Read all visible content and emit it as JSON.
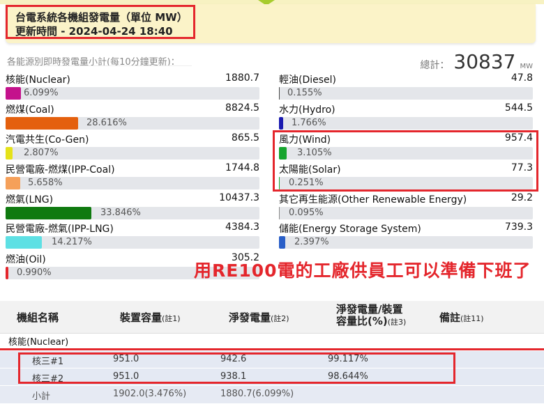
{
  "header": {
    "title": "台電系統各機組發電量（單位 MW）",
    "updated": "更新時間 - 2024-04-24 18:40"
  },
  "summary": {
    "subtitle": "各能源別即時發電量小計(每10分鐘更新)：",
    "total_label": "總計：",
    "total_value": "30837",
    "total_unit": "MW"
  },
  "sources_left": [
    {
      "name": "核能(Nuclear)",
      "value": "1880.7",
      "pct": "6.099%",
      "fraction": 0.061,
      "color": "#c4128c"
    },
    {
      "name": "燃煤(Coal)",
      "value": "8824.5",
      "pct": "28.616%",
      "fraction": 0.286,
      "color": "#e4600e"
    },
    {
      "name": "汽電共生(Co-Gen)",
      "value": "865.5",
      "pct": "2.807%",
      "fraction": 0.028,
      "color": "#e5e21a"
    },
    {
      "name": "民營電廠-燃煤(IPP-Coal)",
      "value": "1744.8",
      "pct": "5.658%",
      "fraction": 0.057,
      "color": "#f5a05a"
    },
    {
      "name": "燃氣(LNG)",
      "value": "10437.3",
      "pct": "33.846%",
      "fraction": 0.338,
      "color": "#0f7a10"
    },
    {
      "name": "民營電廠-燃氣(IPP-LNG)",
      "value": "4384.3",
      "pct": "14.217%",
      "fraction": 0.142,
      "color": "#5ee0e4"
    },
    {
      "name": "燃油(Oil)",
      "value": "305.2",
      "pct": "0.990%",
      "fraction": 0.0099,
      "color": "#e4262c"
    }
  ],
  "sources_right": [
    {
      "name": "輕油(Diesel)",
      "value": "47.8",
      "pct": "0.155%",
      "fraction": 0.00155,
      "color": "#444444"
    },
    {
      "name": "水力(Hydro)",
      "value": "544.5",
      "pct": "1.766%",
      "fraction": 0.0177,
      "color": "#1a1ab0"
    },
    {
      "name": "風力(Wind)",
      "value": "957.4",
      "pct": "3.105%",
      "fraction": 0.031,
      "color": "#17a52e"
    },
    {
      "name": "太陽能(Solar)",
      "value": "77.3",
      "pct": "0.251%",
      "fraction": 0.0025,
      "color": "#17a52e"
    },
    {
      "name": "其它再生能源(Other Renewable Energy)",
      "value": "29.2",
      "pct": "0.095%",
      "fraction": 0.00095,
      "color": "#888888"
    },
    {
      "name": "儲能(Energy Storage System)",
      "value": "739.3",
      "pct": "2.397%",
      "fraction": 0.024,
      "color": "#2a5fc8"
    }
  ],
  "slogan": "用RE100電的工廠供員工可以準備下班了",
  "table": {
    "headers": {
      "unit_name": "機組名稱",
      "capacity": "裝置容量",
      "capacity_note": "(註1)",
      "net_output": "淨發電量",
      "net_output_note": "(註2)",
      "ratio_line1": "淨發電量/裝置",
      "ratio_line2": "容量比(%)",
      "ratio_note": "(註3)",
      "remark": "備註",
      "remark_note": "(註11)"
    },
    "group": "核能(Nuclear)",
    "rows": [
      {
        "name": "核三#1",
        "capacity": "951.0",
        "net": "942.6",
        "ratio": "99.117%"
      },
      {
        "name": "核三#2",
        "capacity": "951.0",
        "net": "938.1",
        "ratio": "98.644%"
      }
    ],
    "subtotal": {
      "name": "小計",
      "capacity": "1902.0(3.476%)",
      "net": "1880.7(6.099%)"
    }
  }
}
